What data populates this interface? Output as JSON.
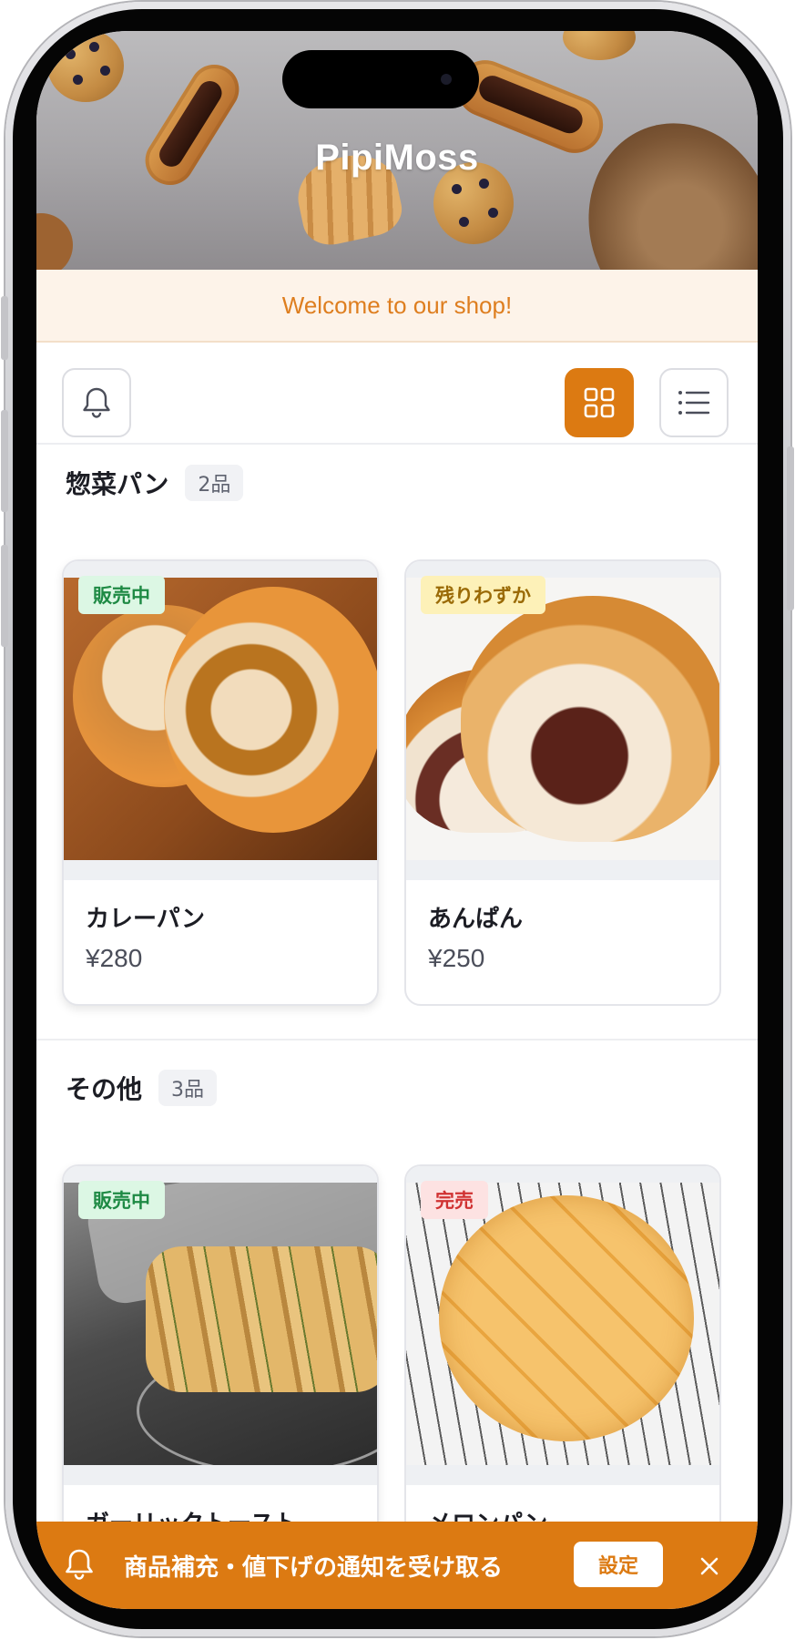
{
  "shop": {
    "name": "PipiMoss",
    "welcome": "Welcome to our shop!"
  },
  "toolbar": {
    "notification_icon": "bell-icon",
    "grid_icon": "grid-view-icon",
    "list_icon": "list-view-icon",
    "active_view": "grid"
  },
  "sections": [
    {
      "title": "惣菜パン",
      "count": "2品",
      "items": [
        {
          "name": "カレーパン",
          "price": "¥280",
          "status": "販売中"
        },
        {
          "name": "あんぱん",
          "price": "¥250",
          "status": "残りわずか"
        }
      ]
    },
    {
      "title": "その他",
      "count": "3品",
      "items": [
        {
          "name": "ガーリックトースト",
          "status": "販売中"
        },
        {
          "name": "メロンパン",
          "status": "完売"
        }
      ]
    }
  ],
  "notify_bar": {
    "text": "商品補充・値下げの通知を受け取る",
    "button": "設定",
    "close_icon": "close-icon"
  },
  "colors": {
    "accent": "#dc7a12",
    "welcome_bg": "#fdf3e9",
    "welcome_text": "#de7e1f",
    "status_on_sale_bg": "#dcf7e4",
    "status_on_sale_text": "#1e8a44",
    "status_low_bg": "#fdf1b8",
    "status_low_text": "#9a6a06",
    "status_sold_out_bg": "#fde2e2",
    "status_sold_out_text": "#d03131"
  }
}
